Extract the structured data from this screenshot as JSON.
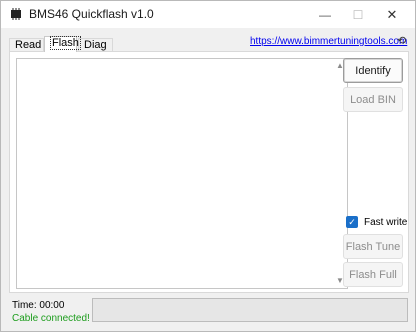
{
  "window": {
    "title": "BMS46 Quickflash v1.0",
    "minimize_glyph": "—",
    "maximize_glyph": "☐",
    "close_glyph": "✕"
  },
  "tabs": [
    {
      "label": "Read",
      "selected": false
    },
    {
      "label": "Flash",
      "selected": true
    },
    {
      "label": "Diag",
      "selected": false
    }
  ],
  "header": {
    "link_text": "https://www.bimmertuningtools.com",
    "refresh_icon": "refresh-icon",
    "refresh_glyph": "⟲"
  },
  "log": {
    "scroll_up_glyph": "▲",
    "scroll_down_glyph": "▼"
  },
  "actions": {
    "identify": "Identify",
    "load_bin": "Load BIN",
    "fast_write_label": "Fast write",
    "fast_write_checked": true,
    "fast_write_glyph": "✓",
    "flash_tune": "Flash Tune",
    "flash_full": "Flash Full"
  },
  "status": {
    "time_label": "Time: 00:00",
    "cable_status": "Cable connected!",
    "progress_fraction": 0
  },
  "colors": {
    "accent": "#1a6fc9",
    "link": "#0000ee",
    "ok": "#1d9d1d",
    "progress": "#06b025"
  }
}
